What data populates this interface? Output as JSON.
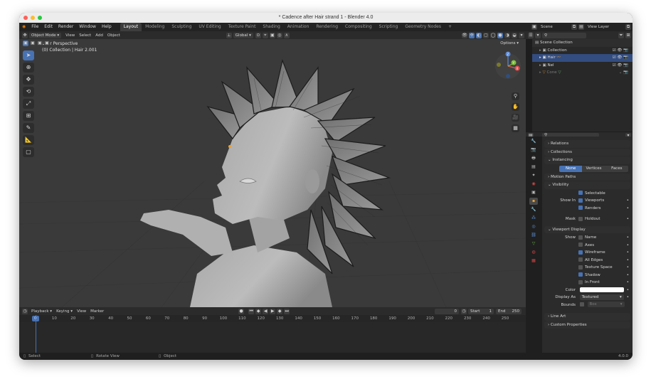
{
  "window": {
    "title": "* Cadence after Hair strand 1 - Blender 4.0"
  },
  "menu": {
    "items": [
      "File",
      "Edit",
      "Render",
      "Window",
      "Help"
    ]
  },
  "workspaces": [
    "Layout",
    "Modeling",
    "Sculpting",
    "UV Editing",
    "Texture Paint",
    "Shading",
    "Animation",
    "Rendering",
    "Compositing",
    "Scripting",
    "Geometry Nodes",
    "+"
  ],
  "active_workspace": "Layout",
  "scene": {
    "scene_name": "Scene",
    "view_layer": "View Layer"
  },
  "viewport_header": {
    "mode": "Object Mode",
    "menus": [
      "View",
      "Select",
      "Add",
      "Object"
    ],
    "transform": "Global",
    "options": "Options"
  },
  "viewport": {
    "perspective": "User Perspective",
    "collection_info": "(0) Collection | Hair 2.001",
    "gizmo_axes": [
      "X",
      "Y",
      "Z"
    ]
  },
  "outliner": {
    "root": "Scene Collection",
    "items": [
      {
        "name": "Collection"
      },
      {
        "name": "Hair"
      },
      {
        "name": "Nel"
      },
      {
        "name": "Cone"
      }
    ]
  },
  "properties": {
    "sections": {
      "relations": "Relations",
      "collections": "Collections",
      "instancing": "Instancing",
      "motion_paths": "Motion Paths",
      "visibility": "Visibility",
      "viewport_display": "Viewport Display",
      "line_art": "Line Art",
      "custom_properties": "Custom Properties"
    },
    "instancing_options": [
      "None",
      "Vertices",
      "Faces"
    ],
    "instancing_selected": "None",
    "visibility": {
      "selectable": "Selectable",
      "show_in": "Show In",
      "viewports": "Viewports",
      "renders": "Renders",
      "mask": "Mask",
      "holdout": "Holdout"
    },
    "viewport_display": {
      "show": "Show",
      "name": "Name",
      "axes": "Axes",
      "wireframe": "Wireframe",
      "all_edges": "All Edges",
      "texture_space": "Texture Space",
      "shadow": "Shadow",
      "in_front": "In Front",
      "color": "Color",
      "display_as": "Display As",
      "display_as_value": "Textured",
      "bounds": "Bounds",
      "bounds_value": "Box"
    }
  },
  "timeline": {
    "menus": [
      "Playback",
      "Keying",
      "View",
      "Marker"
    ],
    "current_frame": "0",
    "start_label": "Start",
    "start": "1",
    "end_label": "End",
    "end": "250",
    "ruler": [
      "0",
      "10",
      "20",
      "30",
      "40",
      "50",
      "60",
      "70",
      "80",
      "90",
      "100",
      "110",
      "120",
      "130",
      "140",
      "150",
      "160",
      "170",
      "180",
      "190",
      "200",
      "210",
      "220",
      "230",
      "240",
      "250"
    ]
  },
  "status_bar": {
    "select": "Select",
    "rotate": "Rotate View",
    "object": "Object",
    "version": "4.0.0"
  },
  "colors": {
    "accent": "#4772b3",
    "background": "#3a3a3a",
    "panel": "#2b2b2b"
  }
}
